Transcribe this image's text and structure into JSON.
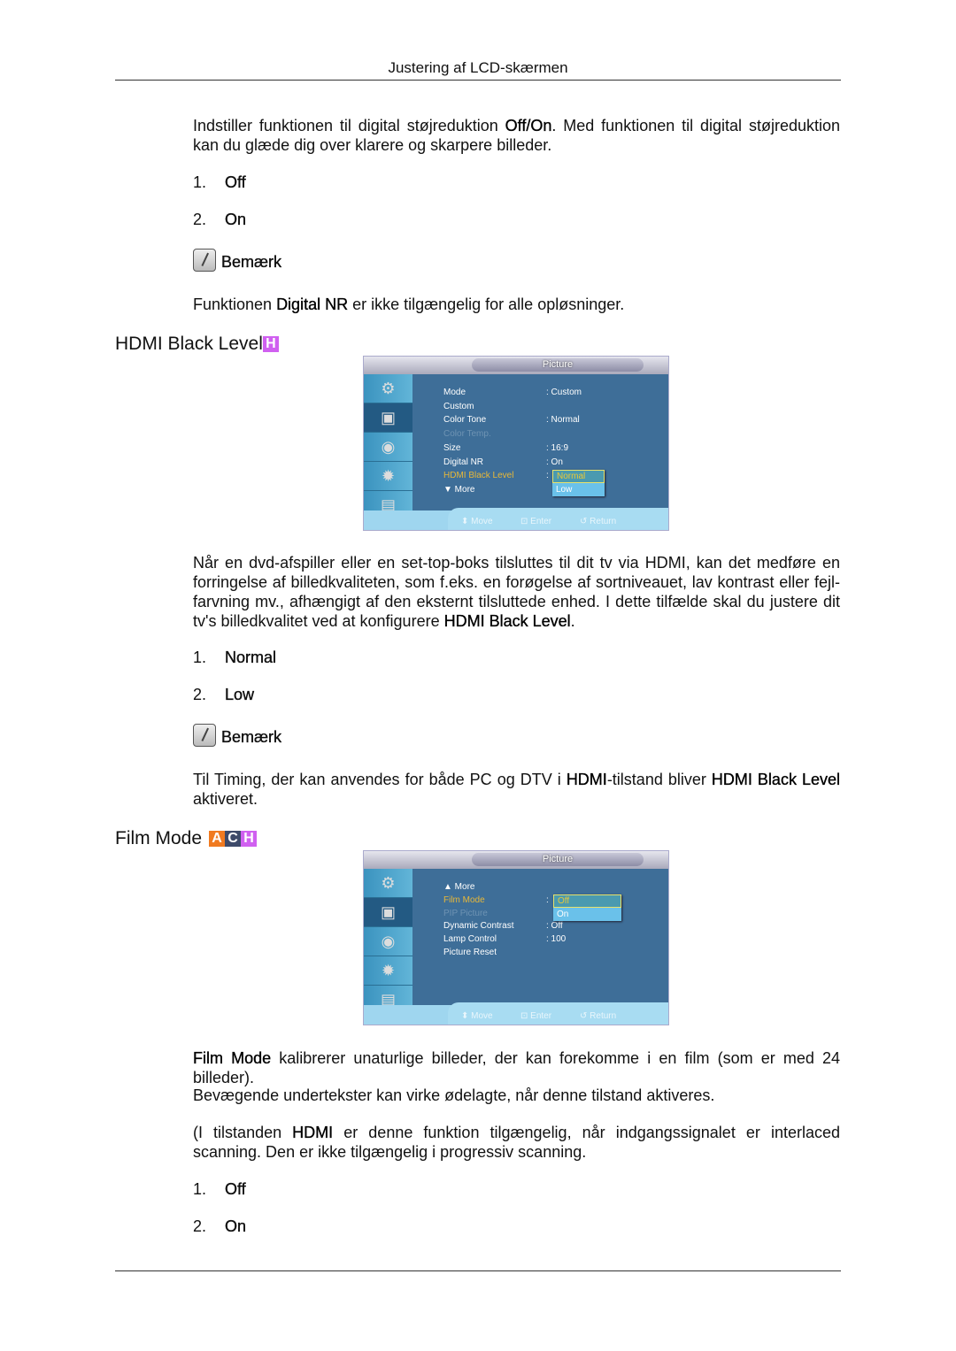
{
  "header": {
    "title": "Justering af LCD-skærmen"
  },
  "colors": {
    "badge_a": "#f07a20",
    "badge_c": "#3d4a6a",
    "badge_h": "#d060f0",
    "osd_panel": "#3e6e98",
    "osd_highlight": "#e8b838"
  },
  "digital_nr": {
    "intro": [
      {
        "t": "Indstiller funktionen til digital støjreduktion "
      },
      {
        "t": "Off/On",
        "b": true
      },
      {
        "t": ". Med funktionen til digital støjreduktion kan du glæde dig over klarere og skarpere billeder."
      }
    ],
    "options": [
      {
        "n": "1.",
        "v": "Off"
      },
      {
        "n": "2.",
        "v": "On"
      }
    ],
    "note_label": "Bemærk",
    "note": [
      {
        "t": "Funktionen "
      },
      {
        "t": "Digital NR",
        "b": true
      },
      {
        "t": " er ikke tilgængelig for alle opløsninger."
      }
    ]
  },
  "hdmi": {
    "heading": "HDMI Black Level",
    "badges": [
      "H"
    ],
    "osd": {
      "title": "Picture",
      "rows": [
        {
          "label": "Mode",
          "value": ": Custom"
        },
        {
          "label": "Custom",
          "value": ""
        },
        {
          "label": "Color Tone",
          "value": ": Normal"
        },
        {
          "label": "Color Temp.",
          "value": "",
          "dim": true
        },
        {
          "label": "Size",
          "value": ": 16:9"
        },
        {
          "label": "Digital NR",
          "value": ": On"
        },
        {
          "label": "HDMI Black Level",
          "value": ":",
          "hl": true
        },
        {
          "label": "▼ More",
          "value": ""
        }
      ],
      "dropdown": [
        "Normal",
        "Low"
      ],
      "footer": [
        "⬍ Move",
        "⊡ Enter",
        "↺ Return"
      ]
    },
    "body": [
      {
        "t": "Når en dvd-afspiller eller en set-top-boks tilsluttes til dit tv via HDMI, kan det medføre en forringelse af billedkvaliteten, som f.eks. en forøgelse af sortniveauet, lav kontrast eller fejl-farvning mv., afhængigt af den eksternt tilsluttede enhed. I dette tilfælde skal du justere dit tv's billedkvalitet ved at konfigurere "
      },
      {
        "t": "HDMI Black Level",
        "b": true
      },
      {
        "t": "."
      }
    ],
    "options": [
      {
        "n": "1.",
        "v": "Normal"
      },
      {
        "n": "2.",
        "v": "Low"
      }
    ],
    "note_label": "Bemærk",
    "note": [
      {
        "t": "Til Timing, der kan anvendes for både PC og DTV i "
      },
      {
        "t": "HDMI",
        "b": true
      },
      {
        "t": "-tilstand bliver "
      },
      {
        "t": "HDMI Black Level",
        "b": true
      },
      {
        "t": " aktiveret."
      }
    ]
  },
  "film": {
    "heading": "Film Mode",
    "badges": [
      "A",
      "C",
      "H"
    ],
    "osd": {
      "title": "Picture",
      "rows": [
        {
          "label": "▲  More",
          "value": ""
        },
        {
          "label": "Film Mode",
          "value": ":",
          "hl": true
        },
        {
          "label": "PIP Picture",
          "value": "",
          "dim": true
        },
        {
          "label": "Dynamic Contrast",
          "value": ": Off"
        },
        {
          "label": "Lamp Control",
          "value": ": 100"
        },
        {
          "label": "Picture Reset",
          "value": ""
        }
      ],
      "dropdown": [
        "Off",
        "On"
      ],
      "footer": [
        "⬍ Move",
        "⊡ Enter",
        "↺ Return"
      ]
    },
    "p1": [
      {
        "t": "Film Mode",
        "b": true
      },
      {
        "t": " kalibrerer unaturlige billeder, der kan forekomme i en film (som er med 24 billeder)."
      }
    ],
    "p2": [
      {
        "t": "Bevægende undertekster kan virke ødelagte, når denne tilstand aktiveres."
      }
    ],
    "p3": [
      {
        "t": "(I tilstanden "
      },
      {
        "t": "HDMI",
        "b": true
      },
      {
        "t": " er denne funktion tilgængelig, når indgangssignalet er interlaced scanning. Den er ikke tilgængelig i progressiv scanning."
      }
    ],
    "options": [
      {
        "n": "1.",
        "v": "Off"
      },
      {
        "n": "2.",
        "v": "On"
      }
    ]
  }
}
